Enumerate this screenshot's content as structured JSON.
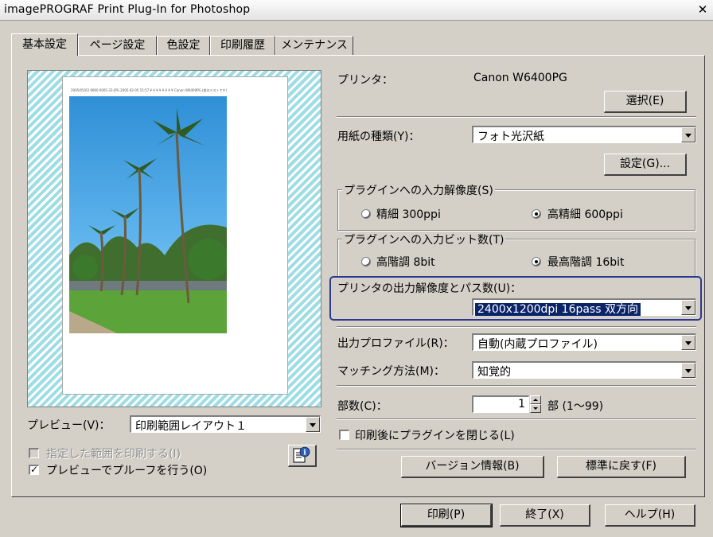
{
  "window": {
    "title": "imagePROGRAF Print Plug-In for Photoshop"
  },
  "tabs": [
    {
      "label": "基本設定",
      "active": true
    },
    {
      "label": "ページ設定"
    },
    {
      "label": "色設定"
    },
    {
      "label": "印刷履歴"
    },
    {
      "label": "メンテナンス"
    }
  ],
  "preview": {
    "paper_header": "2005/05/03 9060 0005-32-JPG 2005-02-05 15:57 ¥ ¥ ¥ ¥ ¥ ¥ ¥ ¥ Canon W6400PG (仮のテストです)",
    "label": "プレビュー(V)：",
    "layout_value": "印刷範囲レイアウト１",
    "print_range_checkbox": "指定した範囲を印刷する(I)",
    "proof_checkbox": "プレビューでプルーフを行う(O)"
  },
  "printer": {
    "label": "プリンタ：",
    "value": "Canon W6400PG",
    "select_button": "選択(E)"
  },
  "media": {
    "label": "用紙の種類(Y)：",
    "value": "フォト光沢紙",
    "settings_button": "設定(G)..."
  },
  "input_resolution": {
    "legend": "プラグインへの入力解像度(S)",
    "option_fine": "精細 300ppi",
    "option_high": "高精細 600ppi",
    "selected": "high"
  },
  "input_bits": {
    "legend": "プラグインへの入力ビット数(T)",
    "option_8": "高階調 8bit",
    "option_16": "最高階調 16bit",
    "selected": "16"
  },
  "output_resolution": {
    "label": "プリンタの出力解像度とパス数(U)：",
    "value": "2400x1200dpi 16pass 双方向"
  },
  "output_profile": {
    "label": "出力プロファイル(R)：",
    "value": "自動(内蔵プロファイル)"
  },
  "matching": {
    "label": "マッチング方法(M)：",
    "value": "知覚的"
  },
  "copies": {
    "label": "部数(C)：",
    "value": "1",
    "unit": "部 (1～99)"
  },
  "close_after_print": {
    "label": "印刷後にプラグインを閉じる(L)",
    "checked": false
  },
  "buttons": {
    "version": "バージョン情報(B)",
    "restore": "標準に戻す(F)",
    "print": "印刷(P)",
    "exit": "終了(X)",
    "help": "ヘルプ(H)"
  },
  "colors": {
    "dialog_bg": "#d4d0c8",
    "selection": "#0a246a",
    "highlight_border": "#2b3a8f",
    "preview_stripes": "#9fdde4"
  }
}
